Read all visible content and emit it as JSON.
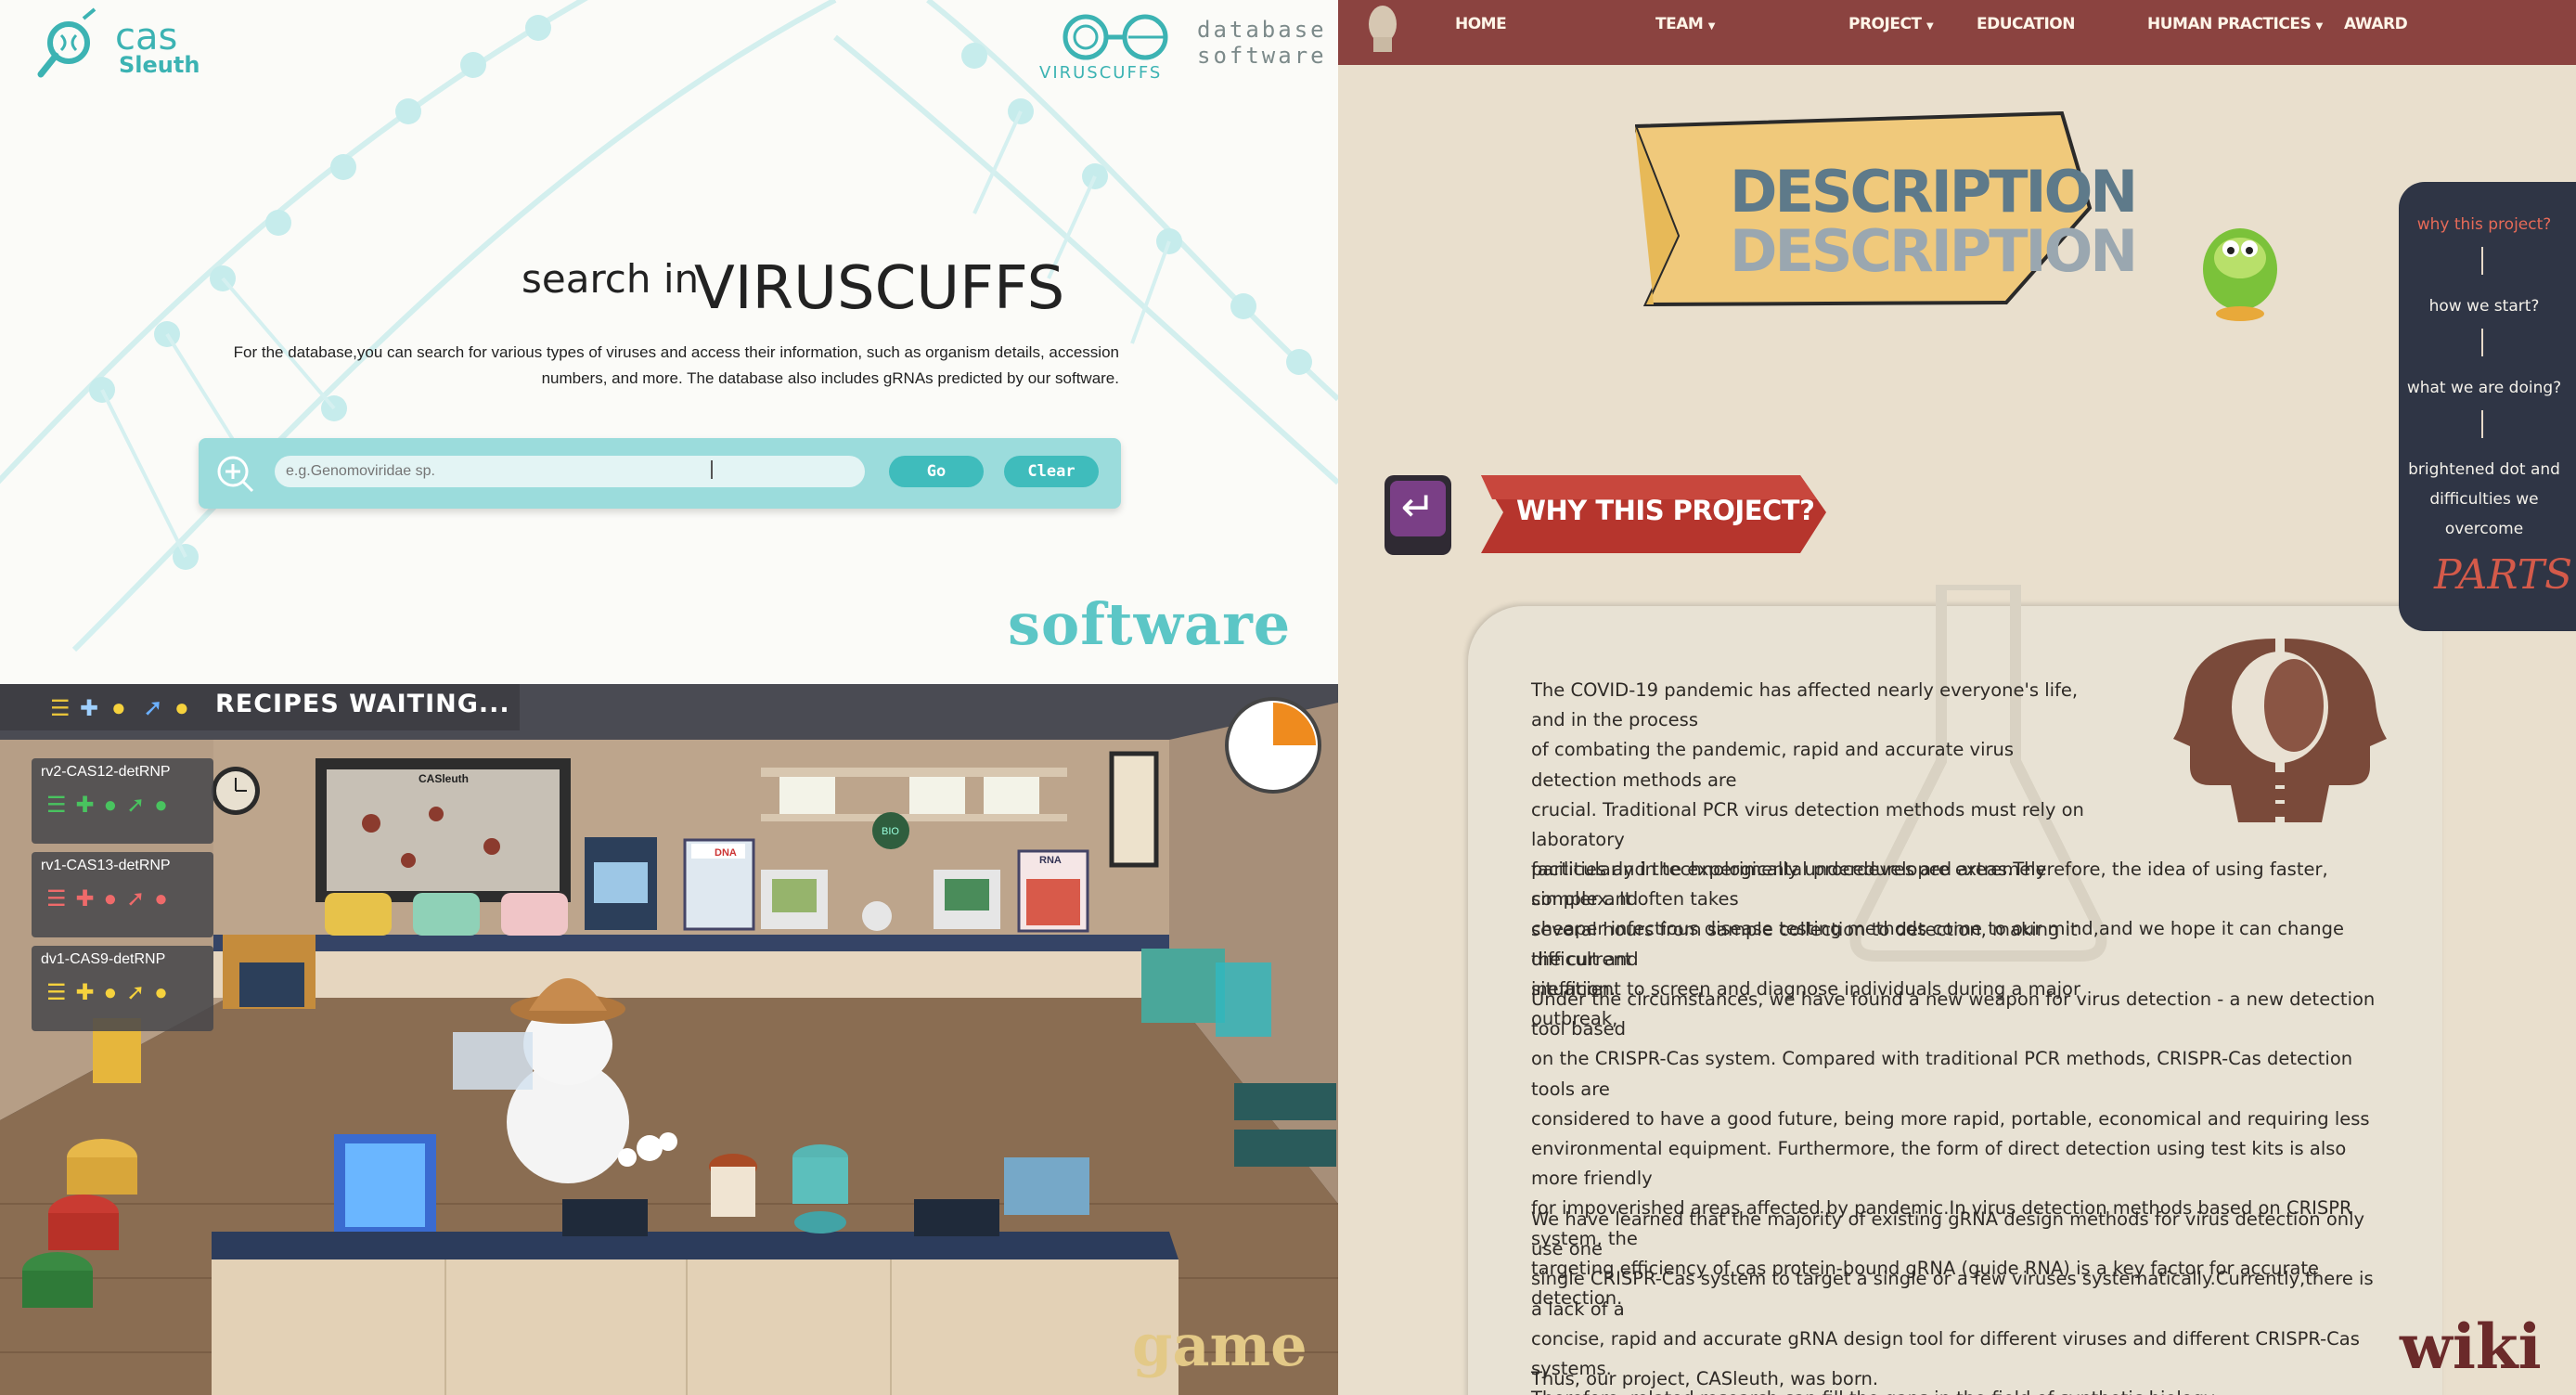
{
  "software": {
    "logo_text_1": "cas",
    "logo_text_2": "Sleuth",
    "brand_name": "VIRUSCUFFS",
    "db_line1": "database",
    "db_line2": "software",
    "search_prefix": "search in",
    "search_brand": "VIRUSCUFFS",
    "description_line1": "For the database,you can search for various types of viruses and access their information, such as organism details, accession",
    "description_line2": "numbers, and more. The database also includes gRNAs predicted by our software.",
    "search_placeholder": "e.g.Genomoviridae sp.",
    "go_label": "Go",
    "clear_label": "Clear",
    "caption": "software",
    "accent": "#3cb3b3"
  },
  "game": {
    "header": "RECIPES WAITING...",
    "recipes": [
      {
        "name": "rv2-CAS12-detRNP"
      },
      {
        "name": "rv1-CAS13-detRNP"
      },
      {
        "name": "dv1-CAS9-detRNP"
      }
    ],
    "board_label": "CASleuth",
    "dna_label": "DNA",
    "rna_label": "RNA",
    "bio_label": "BIO",
    "caption": "game"
  },
  "wiki": {
    "nav": {
      "home": "HOME",
      "team": "TEAM",
      "project": "PROJECT",
      "education": "EDUCATION",
      "human_practices": "HUMAN PRACTICES",
      "award": "AWARD"
    },
    "banner_title": "DESCRIPTION",
    "banner_shadow": "DESCRIPTION",
    "section_title": "WHY THIS PROJECT?",
    "paragraphs": [
      {
        "lines": [
          "The COVID-19 pandemic has affected nearly everyone's life, and in the process",
          "of combating the pandemic, rapid and accurate virus detection methods are",
          "crucial. Traditional PCR virus detection methods must rely on laboratory",
          "facilities and the experimental procedures are extremely complex. It often takes",
          "several hours from sample collection to detection, making it difficult and",
          "inefficient to screen and diagnose individuals during a major outbreak,",
          "particularly in technologically underdeveloped areas.Therefore, the idea of using faster, simpler and",
          "cheaper infectious disease testing methods come to our mind,and we hope it can change the current",
          "situation."
        ]
      },
      {
        "lines": [
          "Under the circumstances, we have found a new weapon for virus detection - a new detection tool based",
          "on the CRISPR-Cas system. Compared with traditional PCR methods, CRISPR-Cas detection tools are",
          "considered to have a good future, being more rapid, portable, economical and requiring less",
          "environmental equipment. Furthermore, the form of direct detection using test kits is also more friendly",
          "for impoverished areas affected by pandemic.In virus detection methods based on CRISPR system, the",
          "targeting efficiency of cas protein-bound gRNA (guide RNA) is a key factor for accurate detection."
        ]
      },
      {
        "lines": [
          "We have learned that the majority of existing gRNA design methods for virus detection only use one",
          "single CRISPR-Cas system to target a single or a few viruses systematically.Currently,there is a lack of a",
          "concise, rapid and accurate gRNA design tool for different viruses and different CRISPR-Cas systems.",
          "Therefore, related research can fill the gaps in the field of synthetic biology."
        ]
      },
      {
        "lines": [
          "Thus, our project, CASleuth, was born."
        ]
      }
    ],
    "side_nav": {
      "item1": "why this project?",
      "item2": "how we start?",
      "item3": "what we are doing?",
      "item4_l1": "brightened dot and",
      "item4_l2": "difficulties we",
      "item4_l3": "overcome",
      "parts": "PARTS"
    },
    "caption": "wiki",
    "nav_color": "#8b4340",
    "accent": "#c0392b"
  }
}
